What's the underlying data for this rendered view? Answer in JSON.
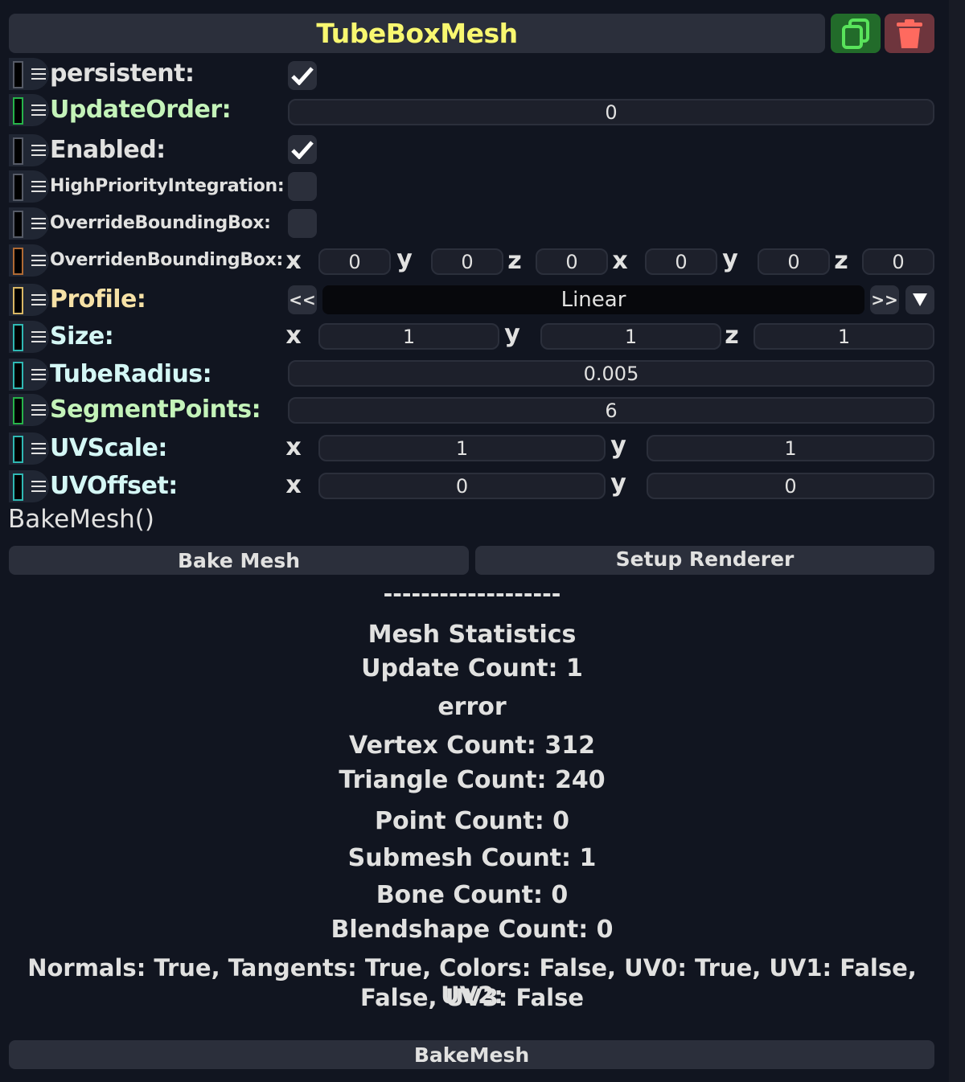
{
  "component": {
    "title": "TubeBoxMesh",
    "duplicate_icon": "duplicate-icon",
    "delete_icon": "trash-icon"
  },
  "colors": {
    "title": "#f8f770",
    "background": "#111520",
    "panel": "#2b2f3b",
    "label_default": "#e1e1e0",
    "label_int": "#c4f3b9",
    "label_float3": "#d4f7f5",
    "label_enum": "#f6e1a6",
    "duplicate_bg": "#226b2a",
    "delete_bg": "#6e353d"
  },
  "fields": {
    "persistent": {
      "label": "persistent:",
      "value": true
    },
    "update_order": {
      "label": "UpdateOrder:",
      "value": "0"
    },
    "enabled": {
      "label": "Enabled:",
      "value": true
    },
    "high_priority": {
      "label": "HighPriorityIntegration:",
      "value": false
    },
    "override_bbox": {
      "label": "OverrideBoundingBox:",
      "value": false
    },
    "overriden_bbox": {
      "label": "OverridenBoundingBox:",
      "axes": [
        "x",
        "y",
        "z",
        "x",
        "y",
        "z"
      ],
      "values": [
        "0",
        "0",
        "0",
        "0",
        "0",
        "0"
      ]
    },
    "profile": {
      "label": "Profile:",
      "prev": "<<",
      "next": ">>",
      "value": "Linear"
    },
    "size": {
      "label": "Size:",
      "axes": [
        "x",
        "y",
        "z"
      ],
      "values": [
        "1",
        "1",
        "1"
      ]
    },
    "tube_radius": {
      "label": "TubeRadius:",
      "value": "0.005"
    },
    "segment_points": {
      "label": "SegmentPoints:",
      "value": "6"
    },
    "uv_scale": {
      "label": "UVScale:",
      "axes": [
        "x",
        "y"
      ],
      "values": [
        "1",
        "1"
      ]
    },
    "uv_offset": {
      "label": "UVOffset:",
      "axes": [
        "x",
        "y"
      ],
      "values": [
        "0",
        "0"
      ]
    }
  },
  "method": {
    "label": "BakeMesh()",
    "bake_button": "Bake Mesh",
    "setup_button": "Setup Renderer"
  },
  "stats": {
    "separator": "-------------------",
    "title": "Mesh Statistics",
    "update_count": "Update Count: 1",
    "error": "error",
    "vertex_count": "Vertex Count: 312",
    "triangle_count": "Triangle Count: 240",
    "point_count": "Point Count: 0",
    "submesh_count": "Submesh Count: 1",
    "bone_count": "Bone Count: 0",
    "blendshape_count": "Blendshape Count: 0",
    "attributes_line1": "Normals: True, Tangents: True, Colors: False, UV0: True, UV1: False, UV2:",
    "attributes_line2": "False, UV3: False"
  },
  "footer": {
    "bake_button": "BakeMesh"
  }
}
